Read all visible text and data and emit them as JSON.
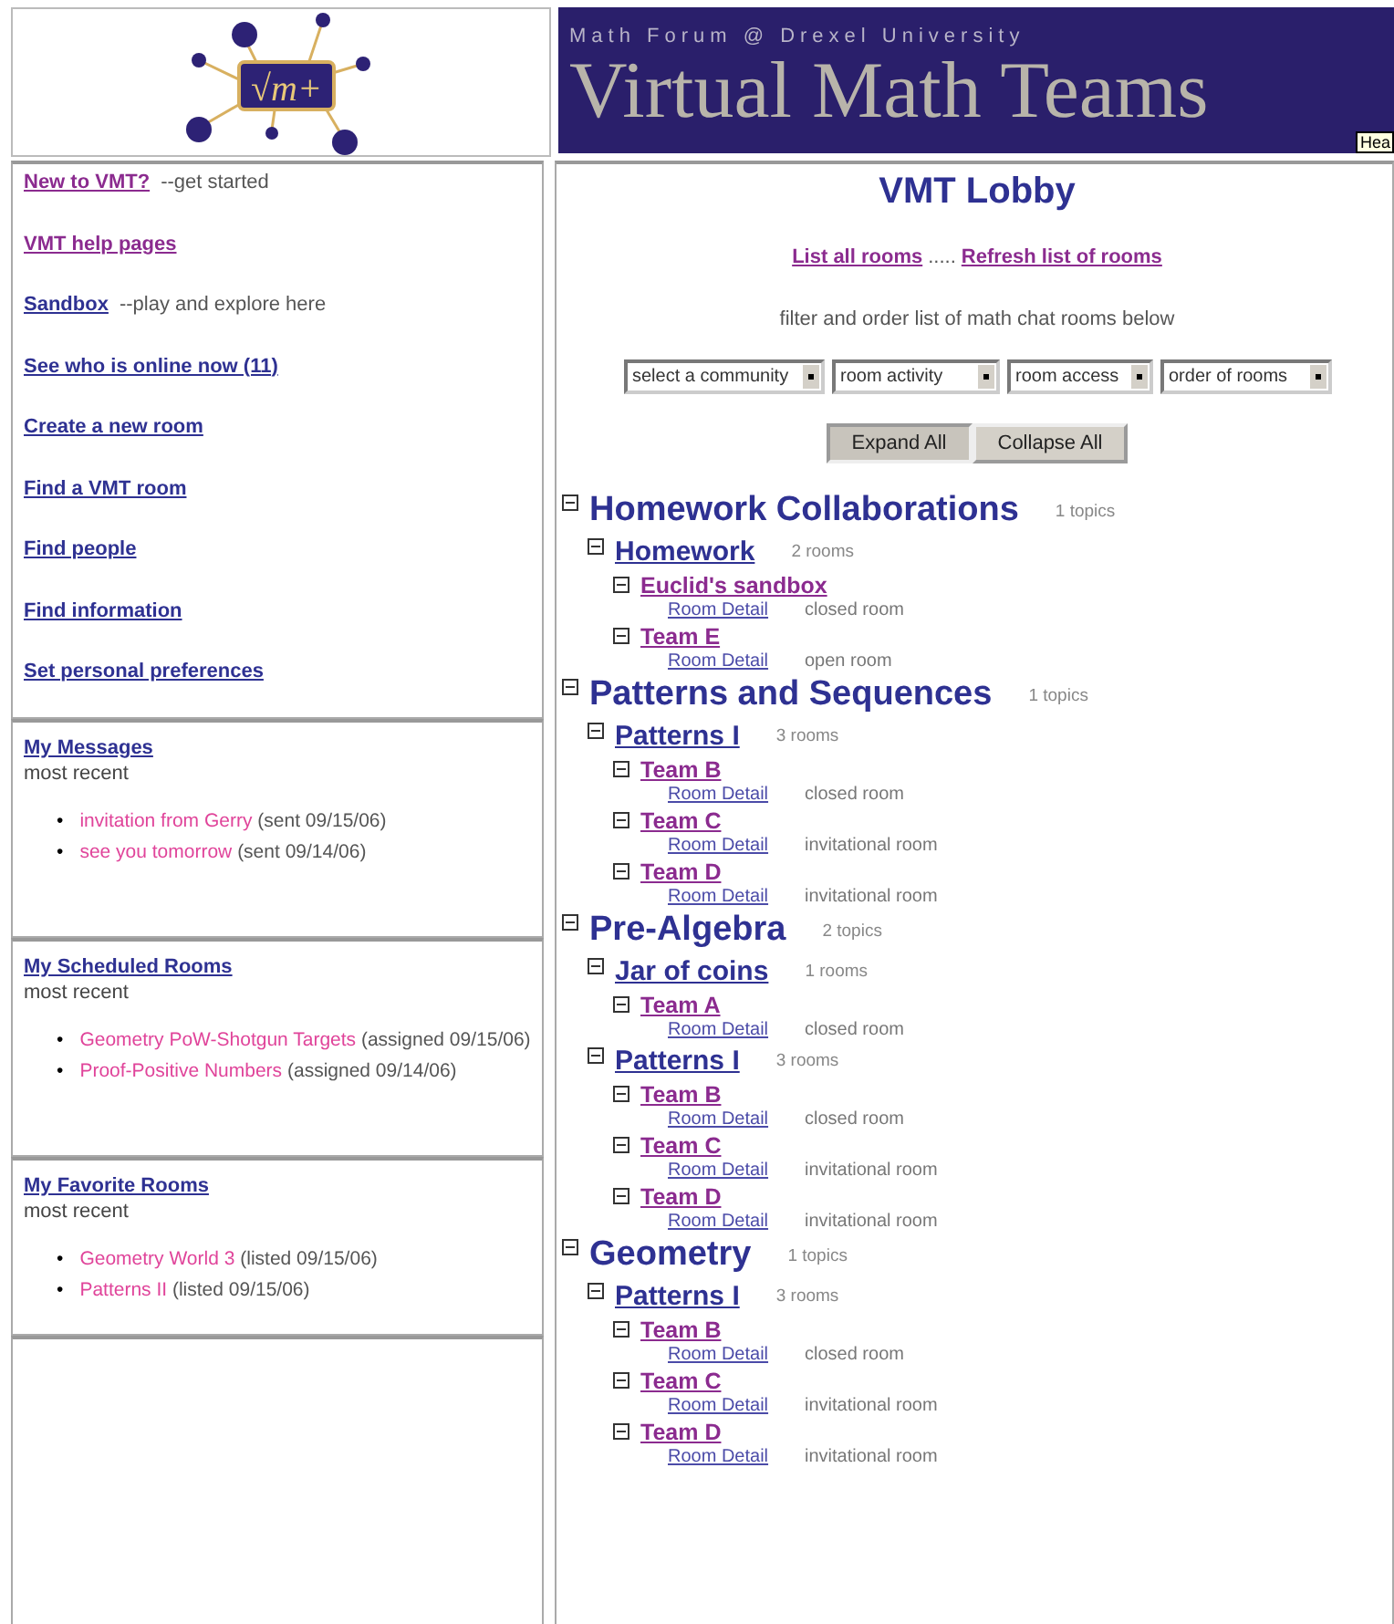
{
  "header": {
    "logo_text": "√m+",
    "subtitle": "Math Forum @ Drexel University",
    "title": "Virtual Math Teams",
    "tooltip": "Hea"
  },
  "nav": [
    {
      "link": "New to VMT?",
      "note": "--get started",
      "visited": true
    },
    {
      "link": "VMT help pages",
      "visited": true
    },
    {
      "link": "Sandbox",
      "note": "--play and explore here",
      "visited": false
    },
    {
      "link": "See who is online now (11)",
      "visited": false
    },
    {
      "link": "Create a new room",
      "visited": false
    },
    {
      "link": "Find a VMT room",
      "visited": false
    },
    {
      "link": "Find people",
      "visited": false
    },
    {
      "link": "Find information",
      "visited": false
    },
    {
      "link": "Set personal preferences",
      "visited": false
    }
  ],
  "bullet": "•",
  "panels": [
    {
      "title": "My Messages",
      "subtitle": "most recent",
      "items": [
        {
          "link": "invitation from Gerry",
          "note": "(sent 09/15/06)"
        },
        {
          "link": "see you tomorrow",
          "note": "(sent 09/14/06)"
        }
      ]
    },
    {
      "title": "My Scheduled Rooms",
      "subtitle": "most recent",
      "items": [
        {
          "link": "Geometry PoW-Shotgun Targets",
          "note": "(assigned 09/15/06)"
        },
        {
          "link": "Proof-Positive Numbers",
          "note": "(assigned 09/14/06)"
        }
      ]
    },
    {
      "title": "My Favorite Rooms",
      "subtitle": "most recent",
      "items": [
        {
          "link": "Geometry World 3",
          "note": "(listed 09/15/06)"
        },
        {
          "link": "Patterns II",
          "note": "(listed 09/15/06)"
        }
      ]
    }
  ],
  "main": {
    "title": "VMT Lobby",
    "links": [
      "List all rooms",
      "Refresh list of rooms"
    ],
    "link_separator": ".....",
    "filter_text": "filter and order list of math chat rooms below",
    "dropdowns": [
      "select a community",
      "room activity",
      "room access",
      "order of rooms"
    ],
    "buttons": [
      {
        "label": "Expand All",
        "selected": true
      },
      {
        "label": "Collapse All",
        "selected": false
      }
    ]
  },
  "tree": [
    {
      "label": "Homework Collaborations",
      "count": "1 topics",
      "children": [
        {
          "label": "Homework",
          "count": "2 rooms",
          "children": [
            {
              "label": "Euclid's sandbox",
              "detail": "Room Detail",
              "access": "closed room"
            },
            {
              "label": "Team E",
              "detail": "Room Detail",
              "access": "open room"
            }
          ]
        }
      ]
    },
    {
      "label": "Patterns and Sequences",
      "count": "1 topics",
      "children": [
        {
          "label": "Patterns I",
          "count": "3 rooms",
          "children": [
            {
              "label": "Team B",
              "detail": "Room Detail",
              "access": "closed room"
            },
            {
              "label": "Team C",
              "detail": "Room Detail",
              "access": "invitational room"
            },
            {
              "label": "Team D",
              "detail": "Room Detail",
              "access": "invitational room"
            }
          ]
        }
      ]
    },
    {
      "label": "Pre-Algebra",
      "count": "2 topics",
      "children": [
        {
          "label": "Jar of coins",
          "count": "1 rooms",
          "children": [
            {
              "label": "Team A",
              "detail": "Room Detail",
              "access": "closed room"
            }
          ]
        },
        {
          "label": "Patterns I",
          "count": "3 rooms",
          "children": [
            {
              "label": "Team B",
              "detail": "Room Detail",
              "access": "closed room"
            },
            {
              "label": "Team C",
              "detail": "Room Detail",
              "access": "invitational room"
            },
            {
              "label": "Team D",
              "detail": "Room Detail",
              "access": "invitational room"
            }
          ]
        }
      ]
    },
    {
      "label": "Geometry",
      "count": "1 topics",
      "children": [
        {
          "label": "Patterns I",
          "count": "3 rooms",
          "children": [
            {
              "label": "Team B",
              "detail": "Room Detail",
              "access": "closed room"
            },
            {
              "label": "Team C",
              "detail": "Room Detail",
              "access": "invitational room"
            },
            {
              "label": "Team D",
              "detail": "Room Detail",
              "access": "invitational room"
            }
          ]
        }
      ]
    }
  ]
}
